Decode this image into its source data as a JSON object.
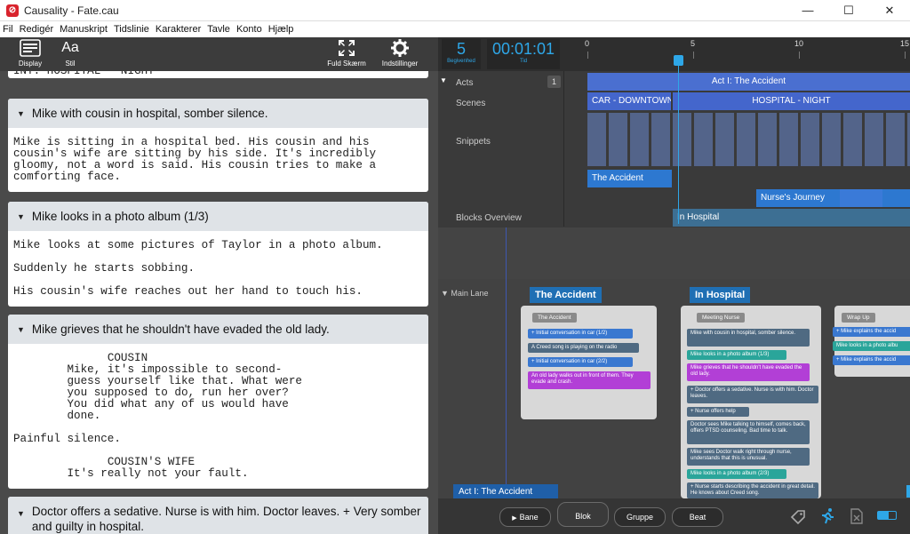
{
  "window": {
    "title": "Causality - Fate.cau",
    "minimize": "—",
    "maximize": "☐",
    "close": "✕"
  },
  "menu": [
    "Fil",
    "Redigér",
    "Manuskript",
    "Tidslinie",
    "Karakterer",
    "Tavle",
    "Konto",
    "Hjælp"
  ],
  "left_toolbar": {
    "display": "Display",
    "stil": "Stil",
    "stil_glyph": "Aa",
    "fullscreen": "Fuld Skærm",
    "settings": "Indstillinger"
  },
  "script": {
    "partial_heading": "INT. HOSPITAL - NIGHT",
    "cards": [
      {
        "title": "Mike with cousin in hospital, somber silence.",
        "paras": [
          "Mike is sitting in a hospital bed. His cousin and his cousin's wife are sitting by his side. It's incredibly gloomy, not a word is said. His cousin tries to make a comforting face."
        ]
      },
      {
        "title": "Mike looks in a photo album (1/3)",
        "paras": [
          "Mike looks at some pictures of Taylor in a photo album.",
          "Suddenly he starts sobbing.",
          "His cousin's wife reaches out her hand to touch his."
        ]
      },
      {
        "title": "Mike grieves that he shouldn't have evaded the old lady.",
        "paras": [
          "              COUSIN\n        Mike, it's impossible to second-\n        guess yourself like that. What were\n        you supposed to do, run her over?\n        You did what any of us would have\n        done.",
          "Painful silence.",
          "              COUSIN'S WIFE\n        It's really not your fault."
        ]
      },
      {
        "title": "Doctor offers a sedative. Nurse is with him. Doctor leaves.  +  Very somber and guilty in hospital.",
        "paras": []
      }
    ]
  },
  "timeline": {
    "counter1": {
      "value": "5",
      "label": "Begivenhed"
    },
    "counter2": {
      "value": "00:01:01",
      "label": "Tid"
    },
    "ruler": [
      "0",
      "5",
      "10",
      "15"
    ],
    "rows": {
      "acts": "Acts",
      "acts_count": "1",
      "scenes": "Scenes",
      "snippets": "Snippets",
      "blocks": "Blocks Overview"
    },
    "act": "Act I: The Accident",
    "scenes": [
      "CAR - DOWNTOWN",
      "HOSPITAL - NIGHT"
    ],
    "blocks": [
      "The Accident",
      "Nurse's Journey",
      "In Hospital"
    ]
  },
  "board": {
    "main_lane": "Main Lane",
    "block_titles": [
      "The Accident",
      "In Hospital"
    ],
    "groups": {
      "accident": {
        "title": "The Accident",
        "beats": [
          "Initial conversation in car (1/2)",
          "A Creed song is playing on the radio",
          "Initial conversation in car (2/2)",
          "An old lady walks out in front of them. They evade and crash."
        ]
      },
      "meeting": {
        "title": "Meeting Nurse",
        "beats": [
          "Mike with cousin in hospital, somber silence.",
          "Mike looks in a photo album (1/3)",
          "Mike grieves that he shouldn't have evaded the old lady.",
          "Doctor offers a sedative. Nurse is with him. Doctor leaves.",
          "Nurse offers help",
          "Doctor sees Mike talking to himself, comes back, offers PTSD counseling. Bad time to talk.",
          "Mike sees Doctor walk right through nurse, understands that this is unusual.",
          "Mike looks in a photo album (2/3)",
          "Nurse starts describing the accident in great detail. He knows about Creed song."
        ]
      },
      "wrap": {
        "title": "Wrap Up",
        "beats": [
          "Mike explains the accid",
          "Mike looks in a photo albu",
          "Mike explains the accid"
        ]
      }
    },
    "act_label": "Act I: The Accident"
  },
  "bottom_tabs": [
    "Bane",
    "Blok",
    "Gruppe",
    "Beat"
  ],
  "colors": {
    "accent": "#2ea7e8",
    "act": "#4a6fd0",
    "scene": "#4466cc",
    "block_title": "#1f6fb4",
    "beat_dark": "#4f6a82",
    "beat_teal": "#2aa59a",
    "beat_purple": "#b23fd6",
    "beat_blue": "#3a78d0"
  }
}
